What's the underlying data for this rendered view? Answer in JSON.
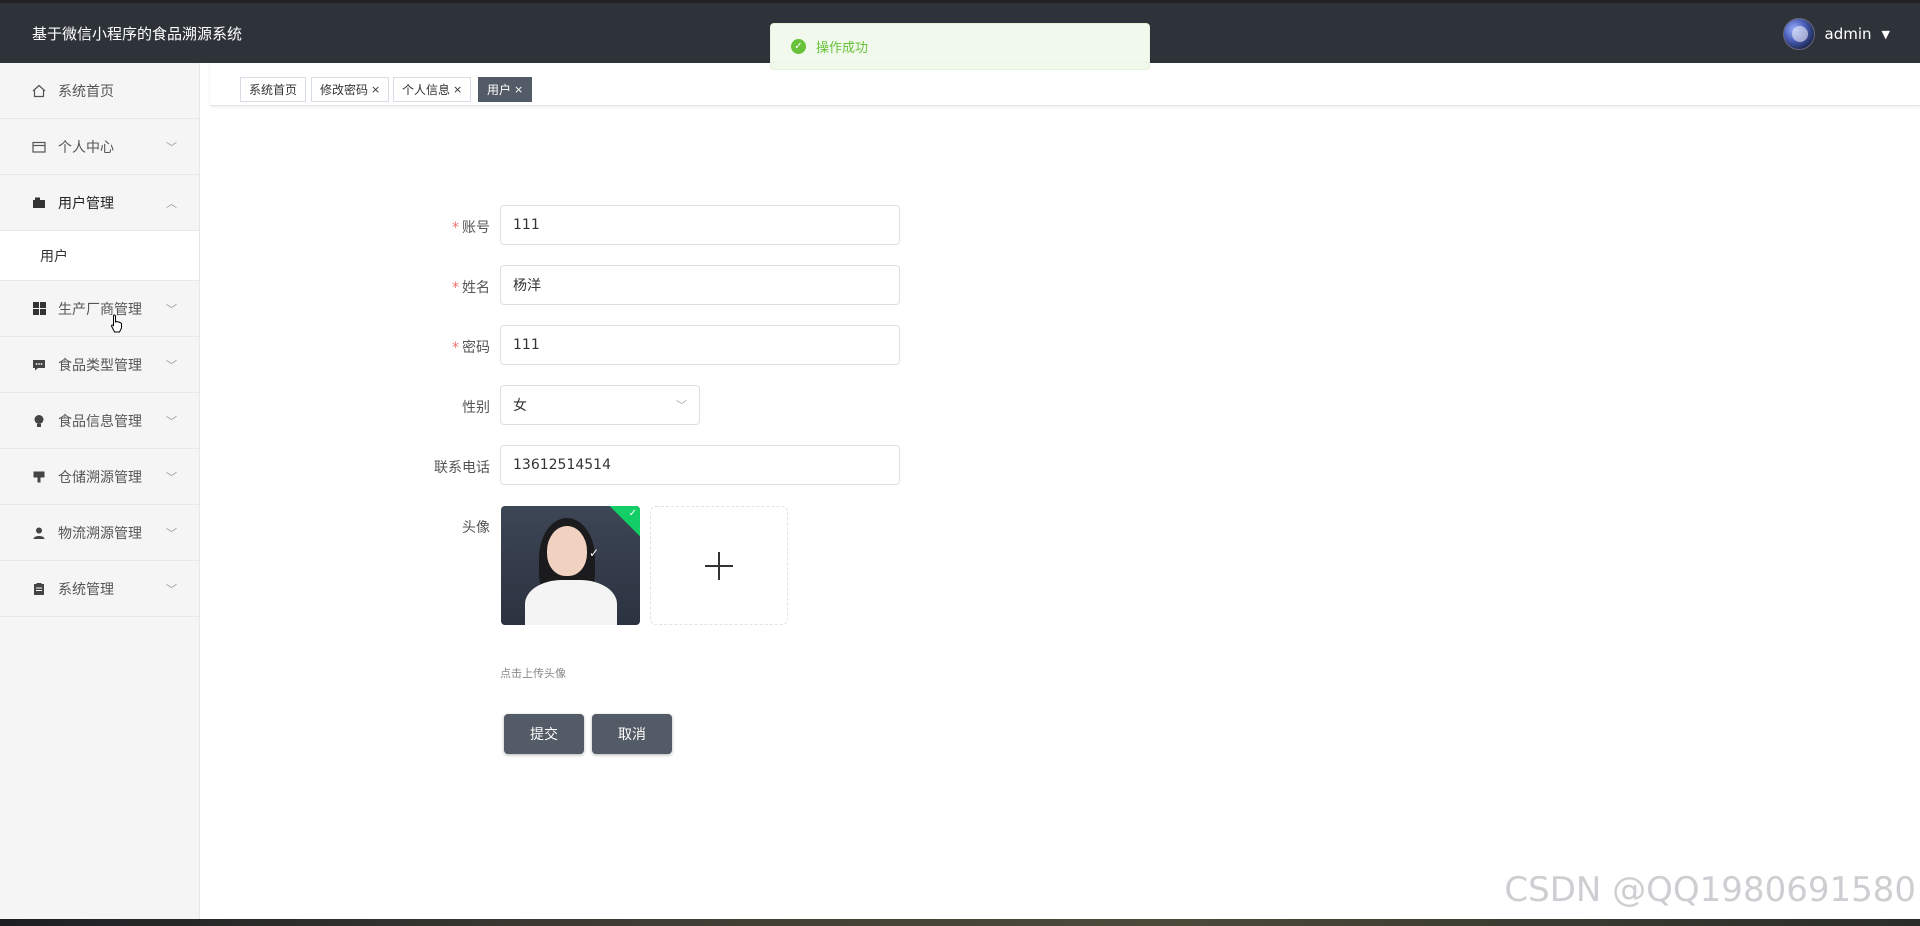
{
  "header": {
    "app_title": "基于微信小程序的食品溯源系统",
    "username": "admin",
    "user_menu_caret": "▼"
  },
  "toast": {
    "message": "操作成功",
    "icon": "check-circle-icon",
    "color": "#67c23a"
  },
  "sidebar": {
    "items": [
      {
        "label": "系统首页",
        "icon": "home-icon"
      },
      {
        "label": "个人中心",
        "icon": "card-icon"
      },
      {
        "label": "用户管理",
        "icon": "folder-icon"
      },
      {
        "label": "用户",
        "icon": ""
      },
      {
        "label": "生产厂商管理",
        "icon": "grid-icon"
      },
      {
        "label": "食品类型管理",
        "icon": "chat-icon"
      },
      {
        "label": "食品信息管理",
        "icon": "bulb-icon"
      },
      {
        "label": "仓储溯源管理",
        "icon": "stamp-icon"
      },
      {
        "label": "物流溯源管理",
        "icon": "user-icon"
      },
      {
        "label": "系统管理",
        "icon": "clipboard-icon"
      }
    ]
  },
  "tabs": [
    {
      "label": "系统首页"
    },
    {
      "label": "修改密码",
      "close": "×"
    },
    {
      "label": "个人信息",
      "close": "×"
    },
    {
      "label": "用户",
      "close": "×"
    }
  ],
  "form": {
    "account": {
      "label": "账号",
      "value": "111"
    },
    "name": {
      "label": "姓名",
      "value": "杨洋"
    },
    "password": {
      "label": "密码",
      "value": "111"
    },
    "gender": {
      "label": "性别",
      "value": "女"
    },
    "phone": {
      "label": "联系电话",
      "value": "13612514514"
    },
    "avatar": {
      "label": "头像",
      "hint": "点击上传头像"
    },
    "required_mark": "*",
    "submit_label": "提交",
    "cancel_label": "取消"
  },
  "watermark": "CSDN @QQ1980691580",
  "colors": {
    "header_bg": "#2e333a",
    "button_bg": "#535b66",
    "required": "#f56c6c",
    "upload_badge": "#13ce66"
  }
}
